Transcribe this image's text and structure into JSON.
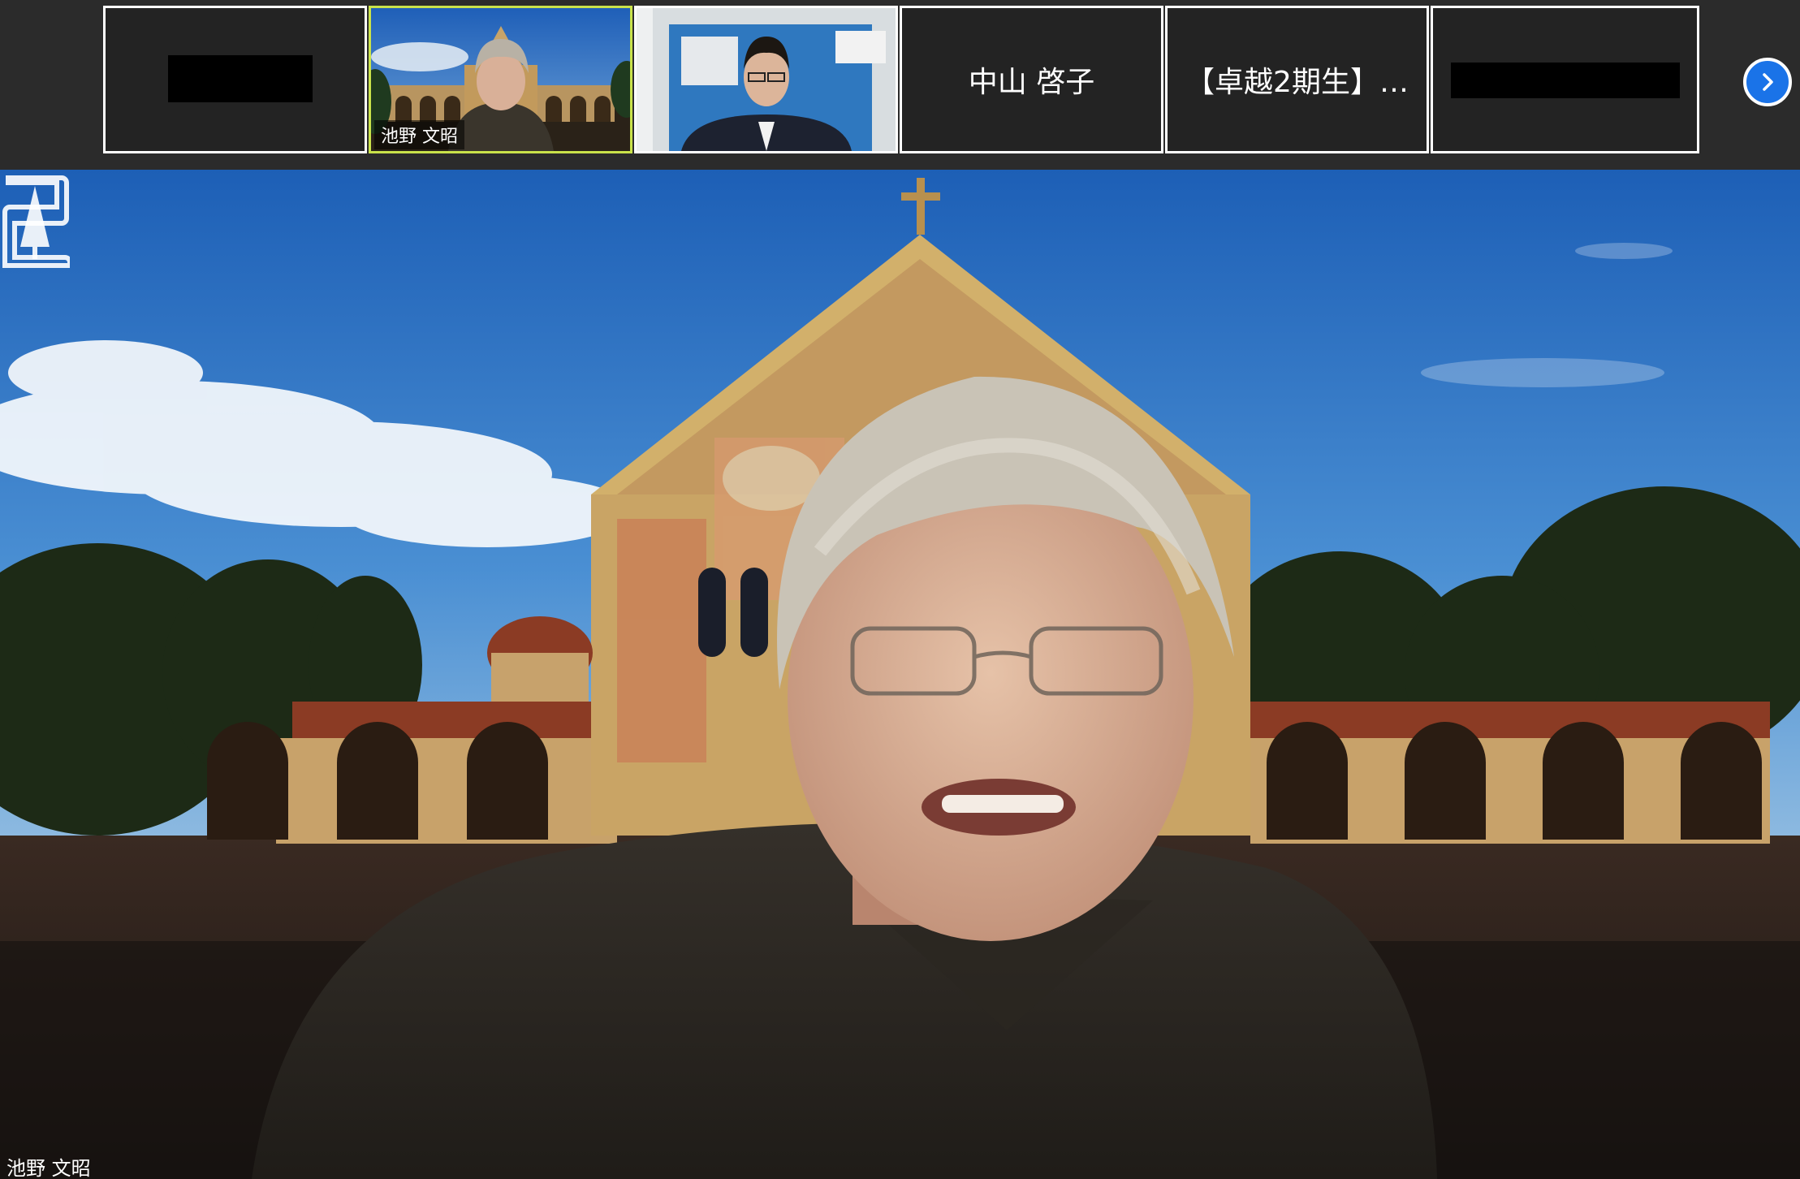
{
  "gallery": {
    "tiles": [
      {
        "id": "tile-1",
        "name": "",
        "redacted": true
      },
      {
        "id": "tile-2",
        "name": "池野 文昭",
        "video": true,
        "active_speaker": true
      },
      {
        "id": "tile-3",
        "name": "",
        "video": true
      },
      {
        "id": "tile-4",
        "name": "中山 啓子"
      },
      {
        "id": "tile-5",
        "name": "【卓越2期生】…"
      },
      {
        "id": "tile-6",
        "name": "",
        "redacted": true
      }
    ],
    "next_page_icon": "chevron-right-icon"
  },
  "main_video": {
    "speaker_name": "池野 文昭",
    "background": "stanford-memorial-church",
    "logo_icon": "stanford-tree-logo"
  },
  "colors": {
    "active_border": "#c9e24a",
    "accent_blue": "#1a73e8",
    "sky": "#2d6fc4"
  }
}
